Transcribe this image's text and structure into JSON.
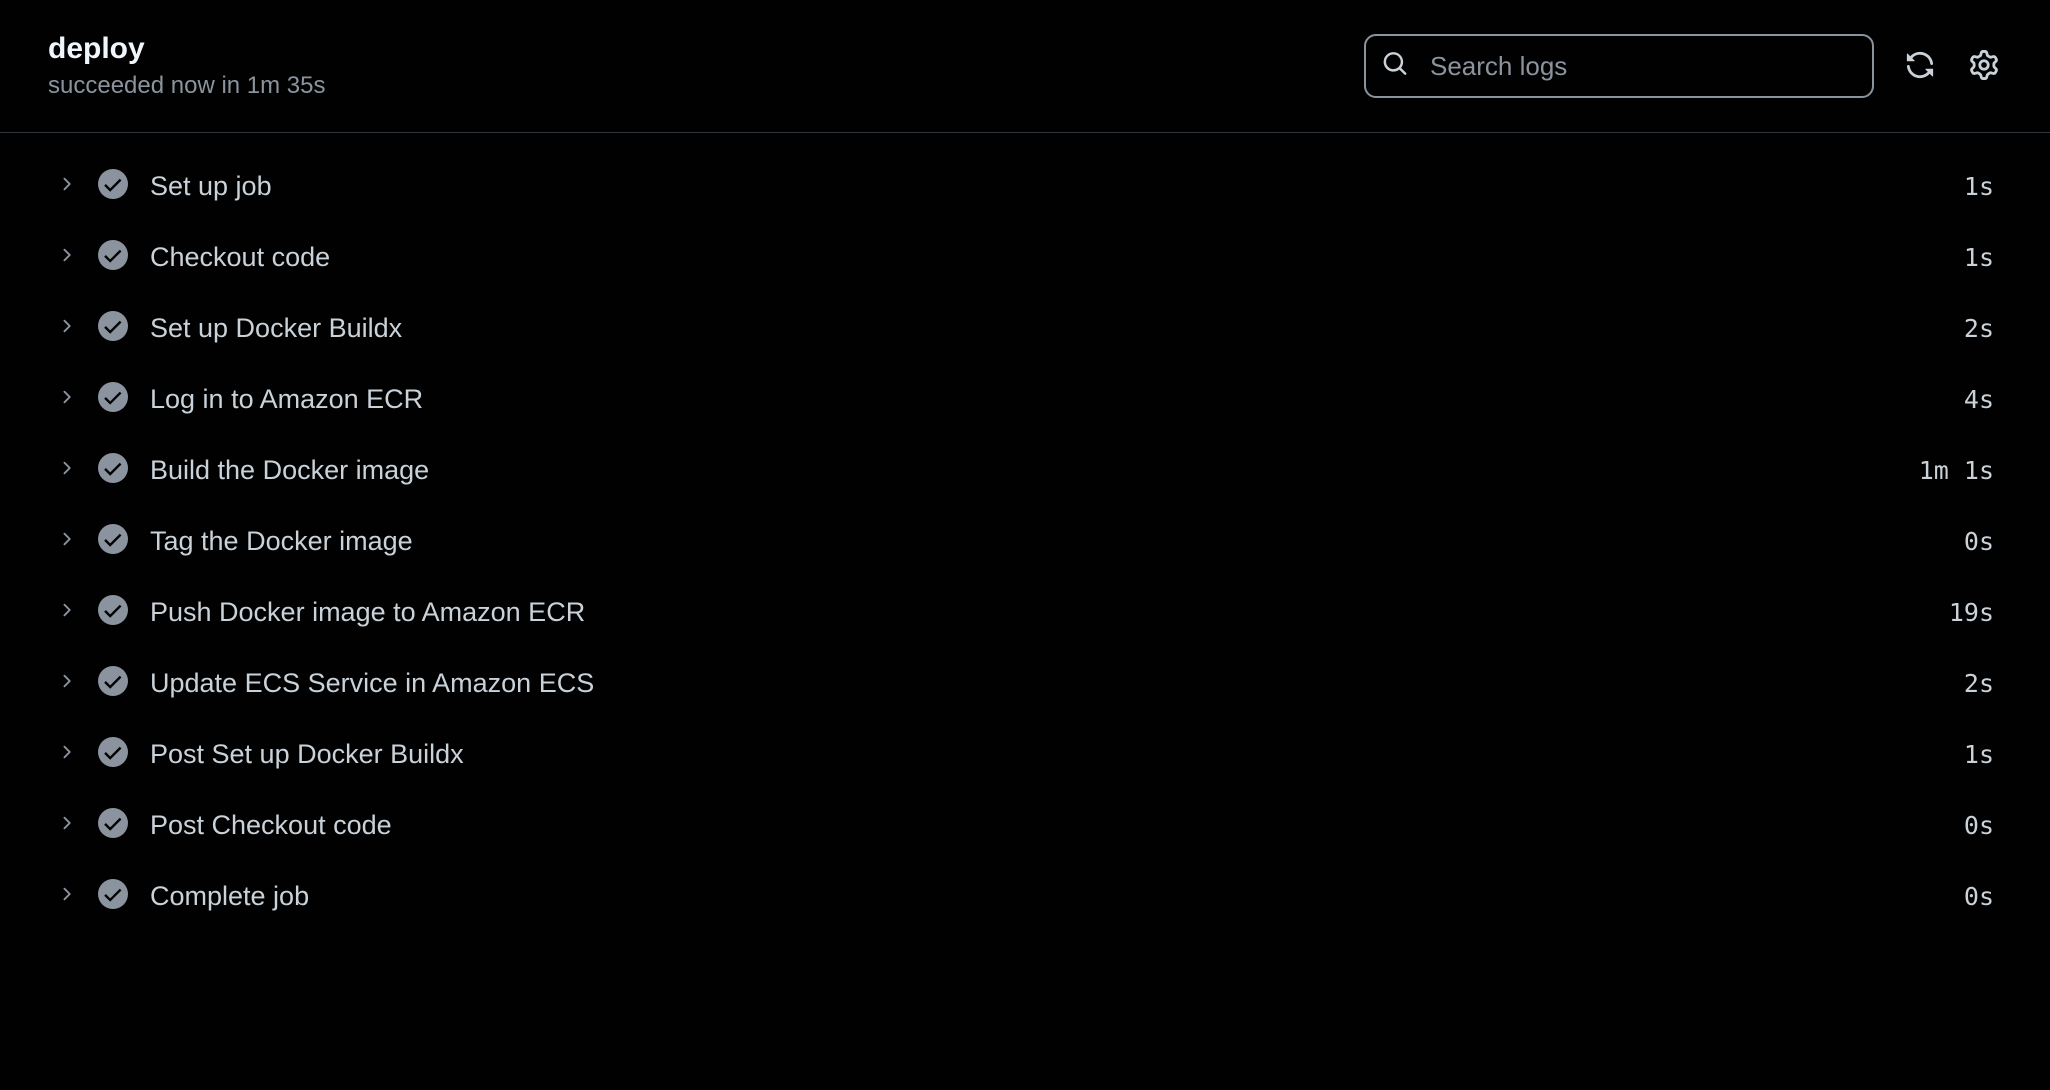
{
  "header": {
    "title": "deploy",
    "status": "succeeded now in 1m 35s"
  },
  "search": {
    "placeholder": "Search logs",
    "value": ""
  },
  "steps": [
    {
      "name": "Set up job",
      "duration": "1s"
    },
    {
      "name": "Checkout code",
      "duration": "1s"
    },
    {
      "name": "Set up Docker Buildx",
      "duration": "2s"
    },
    {
      "name": "Log in to Amazon ECR",
      "duration": "4s"
    },
    {
      "name": "Build the Docker image",
      "duration": "1m 1s"
    },
    {
      "name": "Tag the Docker image",
      "duration": "0s"
    },
    {
      "name": "Push Docker image to Amazon ECR",
      "duration": "19s"
    },
    {
      "name": "Update ECS Service in Amazon ECS",
      "duration": "2s"
    },
    {
      "name": "Post Set up Docker Buildx",
      "duration": "1s"
    },
    {
      "name": "Post Checkout code",
      "duration": "0s"
    },
    {
      "name": "Complete job",
      "duration": "0s"
    }
  ]
}
